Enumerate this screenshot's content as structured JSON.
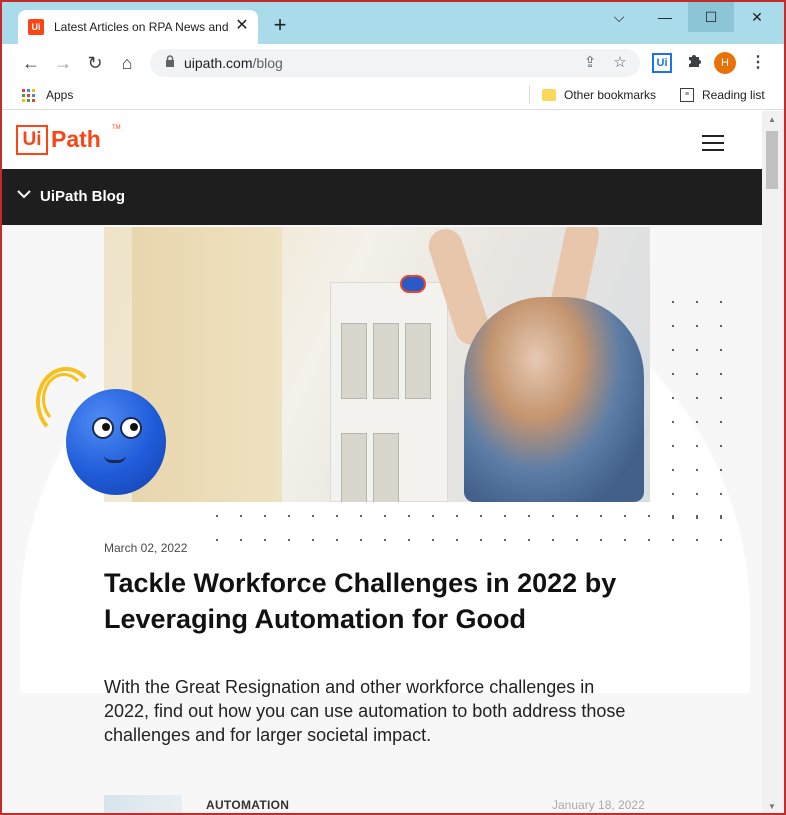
{
  "browser": {
    "tab": {
      "title": "Latest Articles on RPA News and",
      "favicon": "Ui",
      "close_label": "✕"
    },
    "new_tab_label": "+",
    "window_controls": {
      "chevron": "⌵",
      "minimize": "—",
      "maximize": "☐",
      "close": "✕"
    },
    "nav": {
      "back": "←",
      "forward": "→",
      "reload": "↻",
      "home": "⌂"
    },
    "omnibox": {
      "domain": "uipath.com",
      "path": "/blog",
      "lock_icon": "lock-icon",
      "share": "⇪",
      "star": "☆"
    },
    "extensions": {
      "uipath": "Ui",
      "puzzle": "✱",
      "avatar": "H",
      "menu": "⋮"
    },
    "bookmarks": {
      "apps_label": "Apps",
      "other_label": "Other bookmarks",
      "reading_label": "Reading list"
    }
  },
  "site": {
    "logo": {
      "ui": "Ui",
      "path": "Path",
      "tm": "TM"
    },
    "brand_color": "#fa4616",
    "blog_bar": {
      "chevron": "∨",
      "label": "UiPath Blog"
    }
  },
  "article": {
    "date": "March 02, 2022",
    "headline": "Tackle Workforce Challenges in 2022 by Leveraging Automation for Good",
    "excerpt": "With the Great Resignation and other workforce challenges in 2022, find out how you can use automation to both address those challenges and for larger societal impact."
  },
  "next_article": {
    "category": "AUTOMATION",
    "date": "January 18, 2022"
  },
  "scrollbar": {
    "up": "▲",
    "down": "▼"
  }
}
